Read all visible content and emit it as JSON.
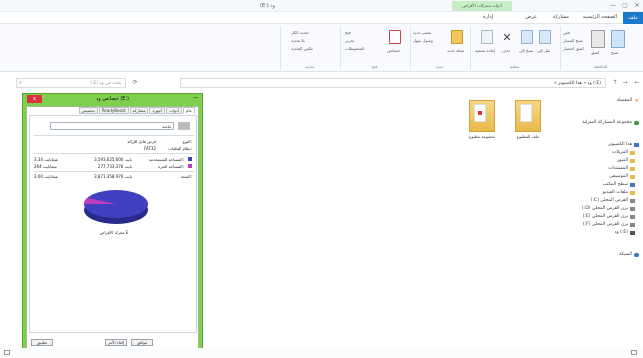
{
  "window": {
    "title": "(E:) ود",
    "context_tab_label": "أدوات محركات الأقراص",
    "buttons": [
      "—",
      "▢",
      "✕"
    ]
  },
  "ribbon": {
    "tabs": [
      "ملف",
      "الصفحة الرئيسية",
      "مشاركة",
      "عرض",
      "إدارة"
    ],
    "groups": [
      {
        "label": "الحافظة",
        "items": [
          "نسخ",
          "لصق",
          "قص",
          "نسخ المسار",
          "لصق اختصار"
        ]
      },
      {
        "label": "تنظيم",
        "items": [
          "نقل إلى",
          "نسخ إلى",
          "حذف",
          "إعادة تسمية"
        ]
      },
      {
        "label": "جديد",
        "items": [
          "مجلد جديد",
          "عنصر جديد",
          "وصول سهل"
        ]
      },
      {
        "label": "فتح",
        "items": [
          "خصائص",
          "فتح",
          "تحرير",
          "المحفوظات"
        ]
      },
      {
        "label": "تحديد",
        "items": [
          "تحديد الكل",
          "بلا تحديد",
          "عكس التحديد"
        ]
      }
    ]
  },
  "address": {
    "path": "(E:) ود « هذا الكمبيوتر «",
    "search_placeholder": "بحث في ود (E:)"
  },
  "navpane": {
    "items": [
      {
        "label": "المفضلة",
        "icon": "star-icon"
      },
      {
        "label": "مجموعة المشاركة المنزلية",
        "icon": "homegroup-icon"
      },
      {
        "label": "هذا الكمبيوتر",
        "icon": "computer-icon"
      },
      {
        "label": "التنزيلات",
        "icon": "folder-icon"
      },
      {
        "label": "الصور",
        "icon": "folder-icon"
      },
      {
        "label": "المستندات",
        "icon": "folder-icon"
      },
      {
        "label": "الموسيقى",
        "icon": "folder-icon"
      },
      {
        "label": "سطح المكتب",
        "icon": "folder-icon"
      },
      {
        "label": "ملفات الفيديو",
        "icon": "folder-icon"
      },
      {
        "label": "القرص المحلي (C:)",
        "icon": "drive-icon"
      },
      {
        "label": "برن القرص المحلي (D:)",
        "icon": "drive-icon"
      },
      {
        "label": "برن القرص المحلي (E:)",
        "icon": "drive-icon"
      },
      {
        "label": "برن القرص المحلي (F:)",
        "icon": "drive-icon"
      },
      {
        "label": "(E:) ود",
        "icon": "drive-icon"
      },
      {
        "label": "الشبكة",
        "icon": "network-icon"
      }
    ]
  },
  "folders": [
    {
      "label": "ملف المطبوع"
    },
    {
      "label": "مجموعة مطبوع"
    }
  ],
  "dialog": {
    "title": "خصائص ود (E:)",
    "close": "x",
    "minimize": "—",
    "tabs": [
      "عام",
      "أدوات",
      "أجهزة",
      "مشاركة",
      "ReadyBoost",
      "تخصيص"
    ],
    "name_value": "ماشة",
    "type_label": "النوع:",
    "type_value": "قرص قابل للإزالة",
    "fs_label": "نظام الملفات:",
    "fs_value": "FAT32",
    "used_label": "المساحة المستخدمة:",
    "used_bytes": "3,593,625,600 بايت",
    "used_gb": "3.34 غيغابايت",
    "free_label": "المساحة الحرة:",
    "free_bytes": "277,733,376 بايت",
    "free_gb": "264 ميغابايت",
    "cap_label": "السعة:",
    "cap_bytes": "3,871,358,976 بايت",
    "cap_gb": "3.60 غيغابايت",
    "drive_label": "محرك الأقراص E",
    "btn_ok": "موافق",
    "btn_cancel": "إلغاء الأمر",
    "btn_apply": "تطبيق",
    "used_fraction": 0.928
  },
  "colors": {
    "dialog_border": "#7fce4e",
    "used": "#4040c0",
    "free": "#c03cbf",
    "file_tab": "#1979ca"
  }
}
